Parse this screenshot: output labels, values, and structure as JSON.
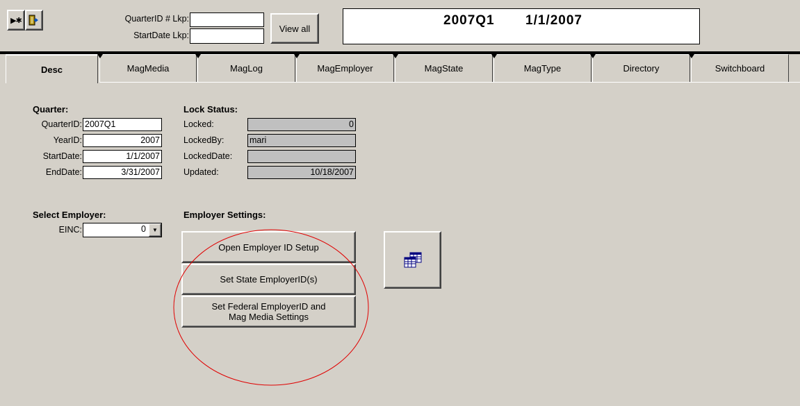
{
  "toolbar": {
    "icon_new": "new-record-icon",
    "icon_exit": "exit-door-icon"
  },
  "lookup": {
    "quarter_label": "QuarterID # Lkp:",
    "quarter_value": "",
    "startdate_label": "StartDate Lkp:",
    "startdate_value": "",
    "view_all": "View all"
  },
  "header_display": {
    "quarter": "2007Q1",
    "date": "1/1/2007"
  },
  "tabs": [
    {
      "label": "Desc",
      "selected": true
    },
    {
      "label": "MagMedia"
    },
    {
      "label": "MagLog"
    },
    {
      "label": "MagEmployer"
    },
    {
      "label": "MagState"
    },
    {
      "label": "MagType"
    },
    {
      "label": "Directory"
    },
    {
      "label": "Switchboard"
    }
  ],
  "quarter": {
    "heading": "Quarter:",
    "quarterid_label": "QuarterID:",
    "quarterid": "2007Q1",
    "yearid_label": "YearID:",
    "yearid": "2007",
    "startdate_label": "StartDate:",
    "startdate": "1/1/2007",
    "enddate_label": "EndDate:",
    "enddate": "3/31/2007"
  },
  "lock": {
    "heading": "Lock Status:",
    "locked_label": "Locked:",
    "locked": "0",
    "lockedby_label": "LockedBy:",
    "lockedby": "mari",
    "lockeddate_label": "LockedDate:",
    "lockeddate": "",
    "updated_label": "Updated:",
    "updated": "10/18/2007"
  },
  "employer_select": {
    "heading": "Select Employer:",
    "einc_label": "EINC:",
    "einc_value": "0"
  },
  "employer_settings": {
    "heading": "Employer Settings:",
    "open_setup": "Open Employer ID Setup",
    "set_state": "Set State EmployerID(s)",
    "set_federal_line1": "Set Federal EmployerID and",
    "set_federal_line2": "Mag Media Settings",
    "side_icon": "grid-table-icon"
  },
  "annotation": {
    "circle_color": "#e00000"
  }
}
